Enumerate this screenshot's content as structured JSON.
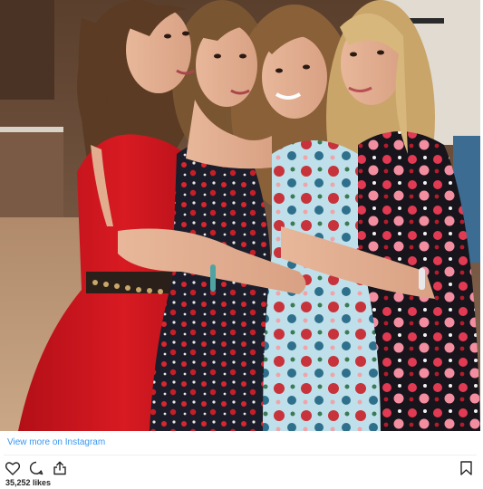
{
  "post": {
    "view_more_label": "View more on Instagram",
    "likes_text": "35,252 likes"
  },
  "icons": {
    "like": "heart-icon",
    "comment": "comment-bubble-icon",
    "share": "share-upload-icon",
    "save": "bookmark-icon"
  },
  "colors": {
    "link": "#3897f0",
    "text": "#262626",
    "red_dress": "#c8141c",
    "floral_dark": "#1a1c2a",
    "floral_light": "#a9d3e0"
  }
}
